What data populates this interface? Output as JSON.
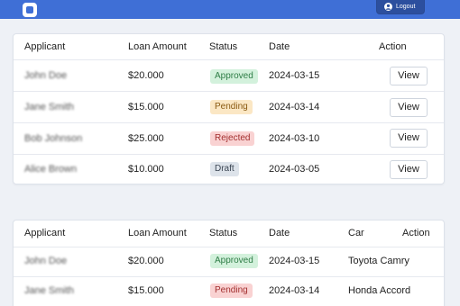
{
  "header": {
    "logout_label": "Logout",
    "brand_color": "#3f6fd6"
  },
  "table1": {
    "columns": {
      "applicant": "Applicant",
      "amount": "Loan Amount",
      "status": "Status",
      "date": "Date",
      "action": "Action"
    },
    "rows": [
      {
        "applicant": "John Doe",
        "amount": "$20.000",
        "status": "Approved",
        "date": "2024-03-15",
        "action": "View"
      },
      {
        "applicant": "Jane Smith",
        "amount": "$15.000",
        "status": "Pending",
        "date": "2024-03-14",
        "action": "View"
      },
      {
        "applicant": "Bob Johnson",
        "amount": "$25.000",
        "status": "Rejected",
        "date": "2024-03-10",
        "action": "View"
      },
      {
        "applicant": "Alice Brown",
        "amount": "$10.000",
        "status": "Draft",
        "date": "2024-03-05",
        "action": "View"
      }
    ]
  },
  "table2": {
    "columns": {
      "applicant": "Applicant",
      "amount": "Loan Amount",
      "status": "Status",
      "date": "Date",
      "car": "Car",
      "action": "Action"
    },
    "rows": [
      {
        "applicant": "John Doe",
        "amount": "$20.000",
        "status": "Approved",
        "date": "2024-03-15",
        "car": "Toyota Camry"
      },
      {
        "applicant": "Jane Smith",
        "amount": "$15.000",
        "status": "Pending",
        "date": "2024-03-14",
        "car": "Honda Accord"
      }
    ]
  },
  "status_colors": {
    "approved": "#2e7d46",
    "pending": "#8a5a12",
    "rejected": "#a33030",
    "draft": "#3c4654"
  }
}
